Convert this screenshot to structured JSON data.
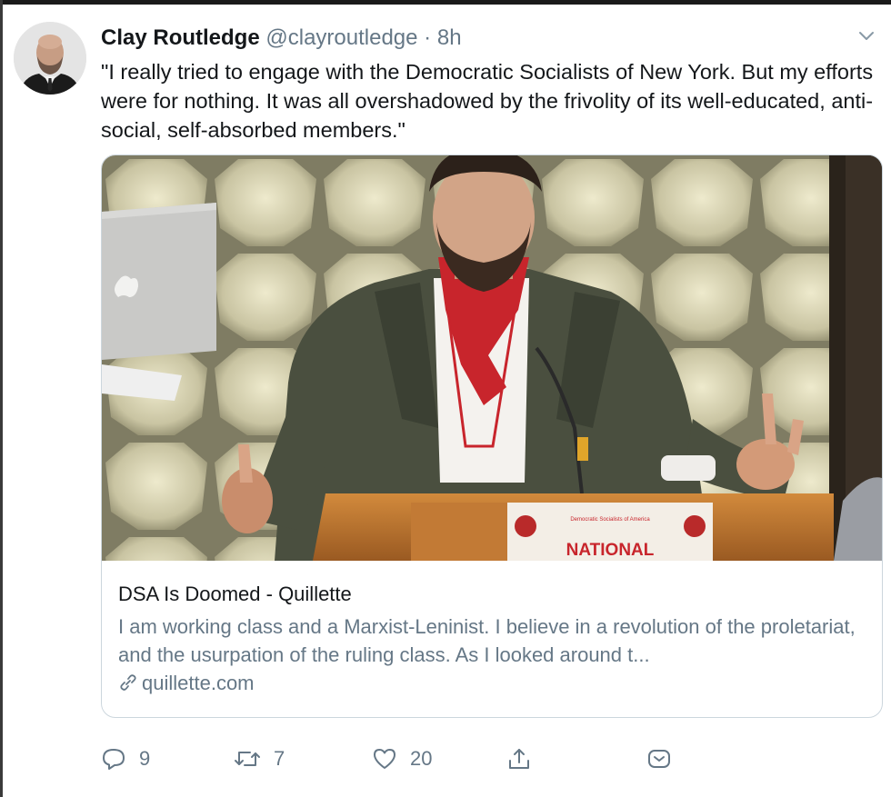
{
  "tweet": {
    "display_name": "Clay Routledge",
    "handle": "@clayroutledge",
    "separator": "·",
    "time": "8h",
    "text": "\"I really tried to engage with the Democratic Socialists of New York. But my efforts were for nothing. It was all overshadowed by the frivolity of its well-educated, anti-social, self-absorbed members.\""
  },
  "card": {
    "title": "DSA Is Doomed - Quillette",
    "description": "I am working class and a Marxist-Leninist. I believe in a revolution of the proletariat, and the usurpation of the ruling class. As I looked around t...",
    "domain": "quillette.com",
    "image": {
      "podium_banner_text": "NATIONAL",
      "podium_small_text": "Democratic Socialists of America",
      "accent_red": "#c8252c",
      "wall_color": "#d8d3b4",
      "jacket_color": "#4a4f3f"
    }
  },
  "actions": {
    "reply_count": "9",
    "retweet_count": "7",
    "like_count": "20"
  },
  "icons": {
    "caret": "chevron-down-icon",
    "reply": "reply-icon",
    "retweet": "retweet-icon",
    "like": "heart-icon",
    "share": "share-icon",
    "dm": "message-icon",
    "link": "link-icon"
  },
  "colors": {
    "text": "#14171a",
    "secondary": "#657786",
    "border": "#ccd6dd"
  }
}
